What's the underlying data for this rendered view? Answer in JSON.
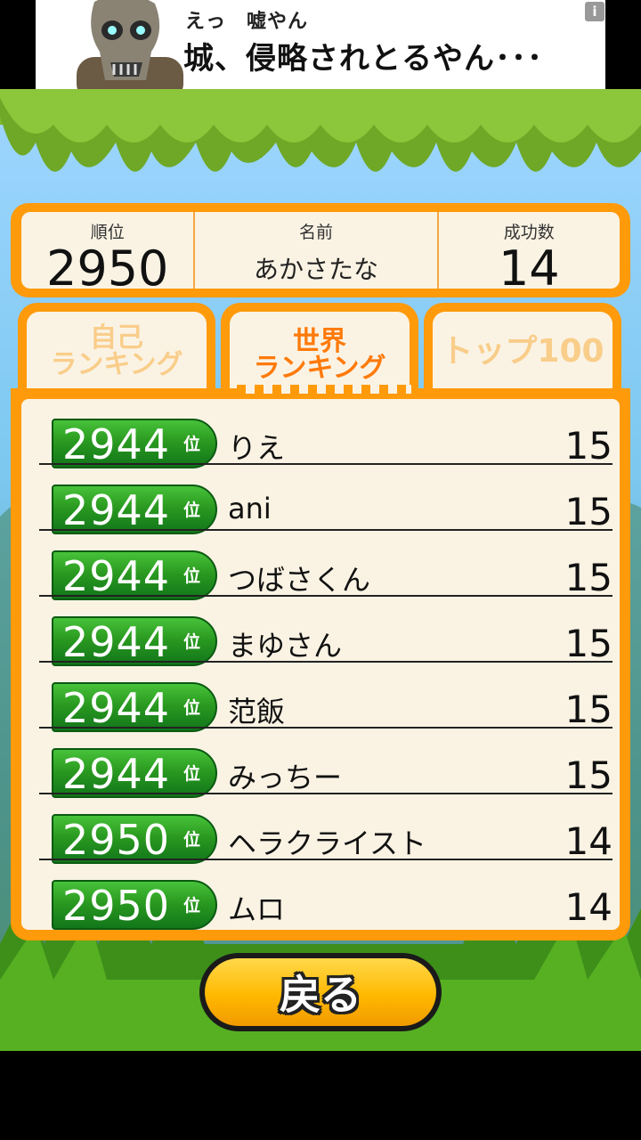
{
  "ad": {
    "subtitle": "えっ　嘘やん",
    "headline": "城、侵略されとるやん･･･",
    "info_icon": "info-icon"
  },
  "header": {
    "rank_label": "順位",
    "rank_value": "2950",
    "name_label": "名前",
    "name_value": "あかさたな",
    "success_label": "成功数",
    "success_value": "14"
  },
  "tabs": [
    {
      "line1": "自己",
      "line2": "ランキング",
      "active": false
    },
    {
      "line1": "世界",
      "line2": "ランキング",
      "active": true
    },
    {
      "line1": "トップ100",
      "line2": "",
      "active": false
    }
  ],
  "rank_suffix": "位",
  "rows": [
    {
      "rank": "2944",
      "name": "りえ",
      "score": "15"
    },
    {
      "rank": "2944",
      "name": "ani",
      "score": "15"
    },
    {
      "rank": "2944",
      "name": "つばさくん",
      "score": "15"
    },
    {
      "rank": "2944",
      "name": "まゆさん",
      "score": "15"
    },
    {
      "rank": "2944",
      "name": "范飯",
      "score": "15"
    },
    {
      "rank": "2944",
      "name": "みっちー",
      "score": "15"
    },
    {
      "rank": "2950",
      "name": "ヘラクライスト",
      "score": "14"
    },
    {
      "rank": "2950",
      "name": "ムロ",
      "score": "14"
    }
  ],
  "back_button": "戻る",
  "colors": {
    "frame": "#ff9a0a",
    "panel": "#faf3e4",
    "badge_green": "#2a9a20",
    "button_yellow": "#ffb800"
  }
}
